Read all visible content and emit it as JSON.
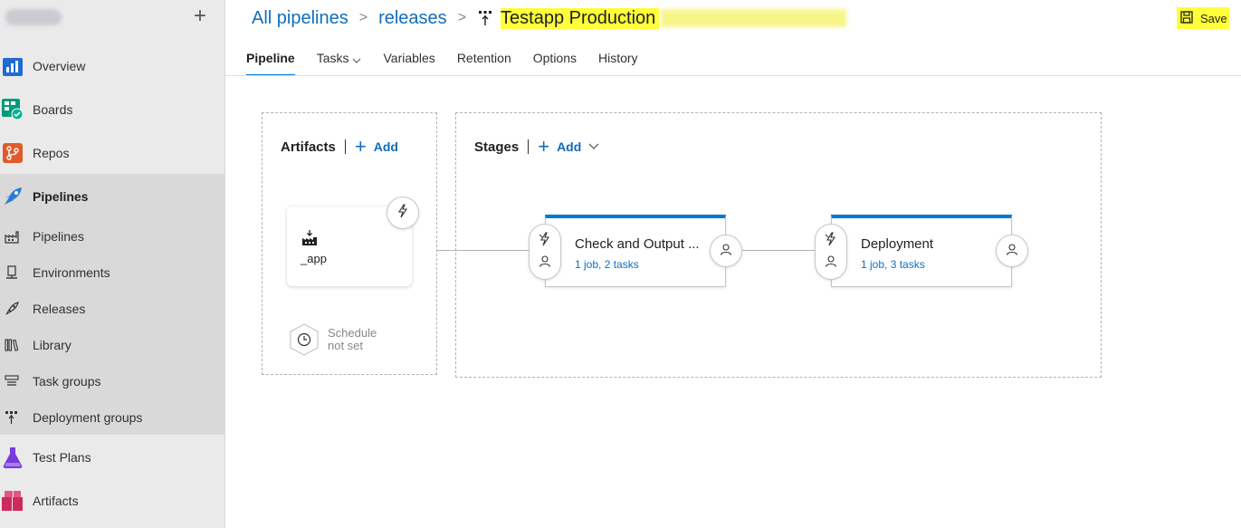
{
  "sidebar": {
    "org_add": "+",
    "items": [
      {
        "label": "Overview"
      },
      {
        "label": "Boards"
      },
      {
        "label": "Repos"
      },
      {
        "label": "Pipelines"
      },
      {
        "label": "Test Plans"
      },
      {
        "label": "Artifacts"
      }
    ],
    "sub_items": [
      {
        "label": "Pipelines"
      },
      {
        "label": "Environments"
      },
      {
        "label": "Releases"
      },
      {
        "label": "Library"
      },
      {
        "label": "Task groups"
      },
      {
        "label": "Deployment groups"
      }
    ]
  },
  "header": {
    "breadcrumb": [
      "All pipelines",
      "releases"
    ],
    "separator": ">",
    "title": "Testapp Production",
    "save_label": "Save",
    "highlight_color": "#ffff3a"
  },
  "tabs": [
    {
      "label": "Pipeline",
      "active": true
    },
    {
      "label": "Tasks"
    },
    {
      "label": "Variables"
    },
    {
      "label": "Retention"
    },
    {
      "label": "Options"
    },
    {
      "label": "History"
    }
  ],
  "artifacts": {
    "heading": "Artifacts",
    "add_label": "Add",
    "artifact_name": "_app",
    "schedule_text_1": "Schedule",
    "schedule_text_2": "not set"
  },
  "stages": {
    "heading": "Stages",
    "add_label": "Add",
    "items": [
      {
        "name": "Check and Output ...",
        "summary": "1 job, 2 tasks"
      },
      {
        "name": "Deployment",
        "summary": "1 job, 3 tasks"
      }
    ]
  },
  "colors": {
    "accent": "#0078d4",
    "link": "#106ebe"
  }
}
